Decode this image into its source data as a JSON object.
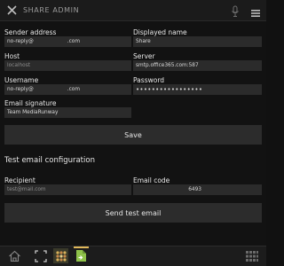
{
  "header": {
    "title": "SHARE ADMIN",
    "close_icon": "close-icon",
    "mic_icon": "microphone-icon",
    "menu_icon": "menu-icon"
  },
  "form": {
    "sender_address": {
      "label": "Sender address",
      "value_prefix": "no-reply@",
      "value_suffix": ".com"
    },
    "displayed_name": {
      "label": "Displayed name",
      "value": "Share"
    },
    "host": {
      "label": "Host",
      "placeholder": "localhost"
    },
    "server": {
      "label": "Server",
      "value": "smtp.office365.com:587"
    },
    "username": {
      "label": "Username",
      "value_prefix": "no-reply@",
      "value_suffix": ".com"
    },
    "password": {
      "label": "Password",
      "value": "•••••••••••••••••"
    },
    "email_signature": {
      "label": "Email signature",
      "value": "Team MediaRunway"
    },
    "save_label": "Save"
  },
  "test_email": {
    "title": "Test email configuration",
    "recipient": {
      "label": "Recipient",
      "placeholder": "test@mail.com"
    },
    "email_code": {
      "label": "Email code",
      "value": "6493"
    },
    "send_label": "Send test email"
  },
  "footer": {
    "icons": [
      "home-icon",
      "fullscreen-icon",
      "apps-grid-icon",
      "file-export-icon",
      "keypad-icon"
    ],
    "accent_color": "#7fb13a",
    "active_tab_color": "#e0b85a"
  }
}
